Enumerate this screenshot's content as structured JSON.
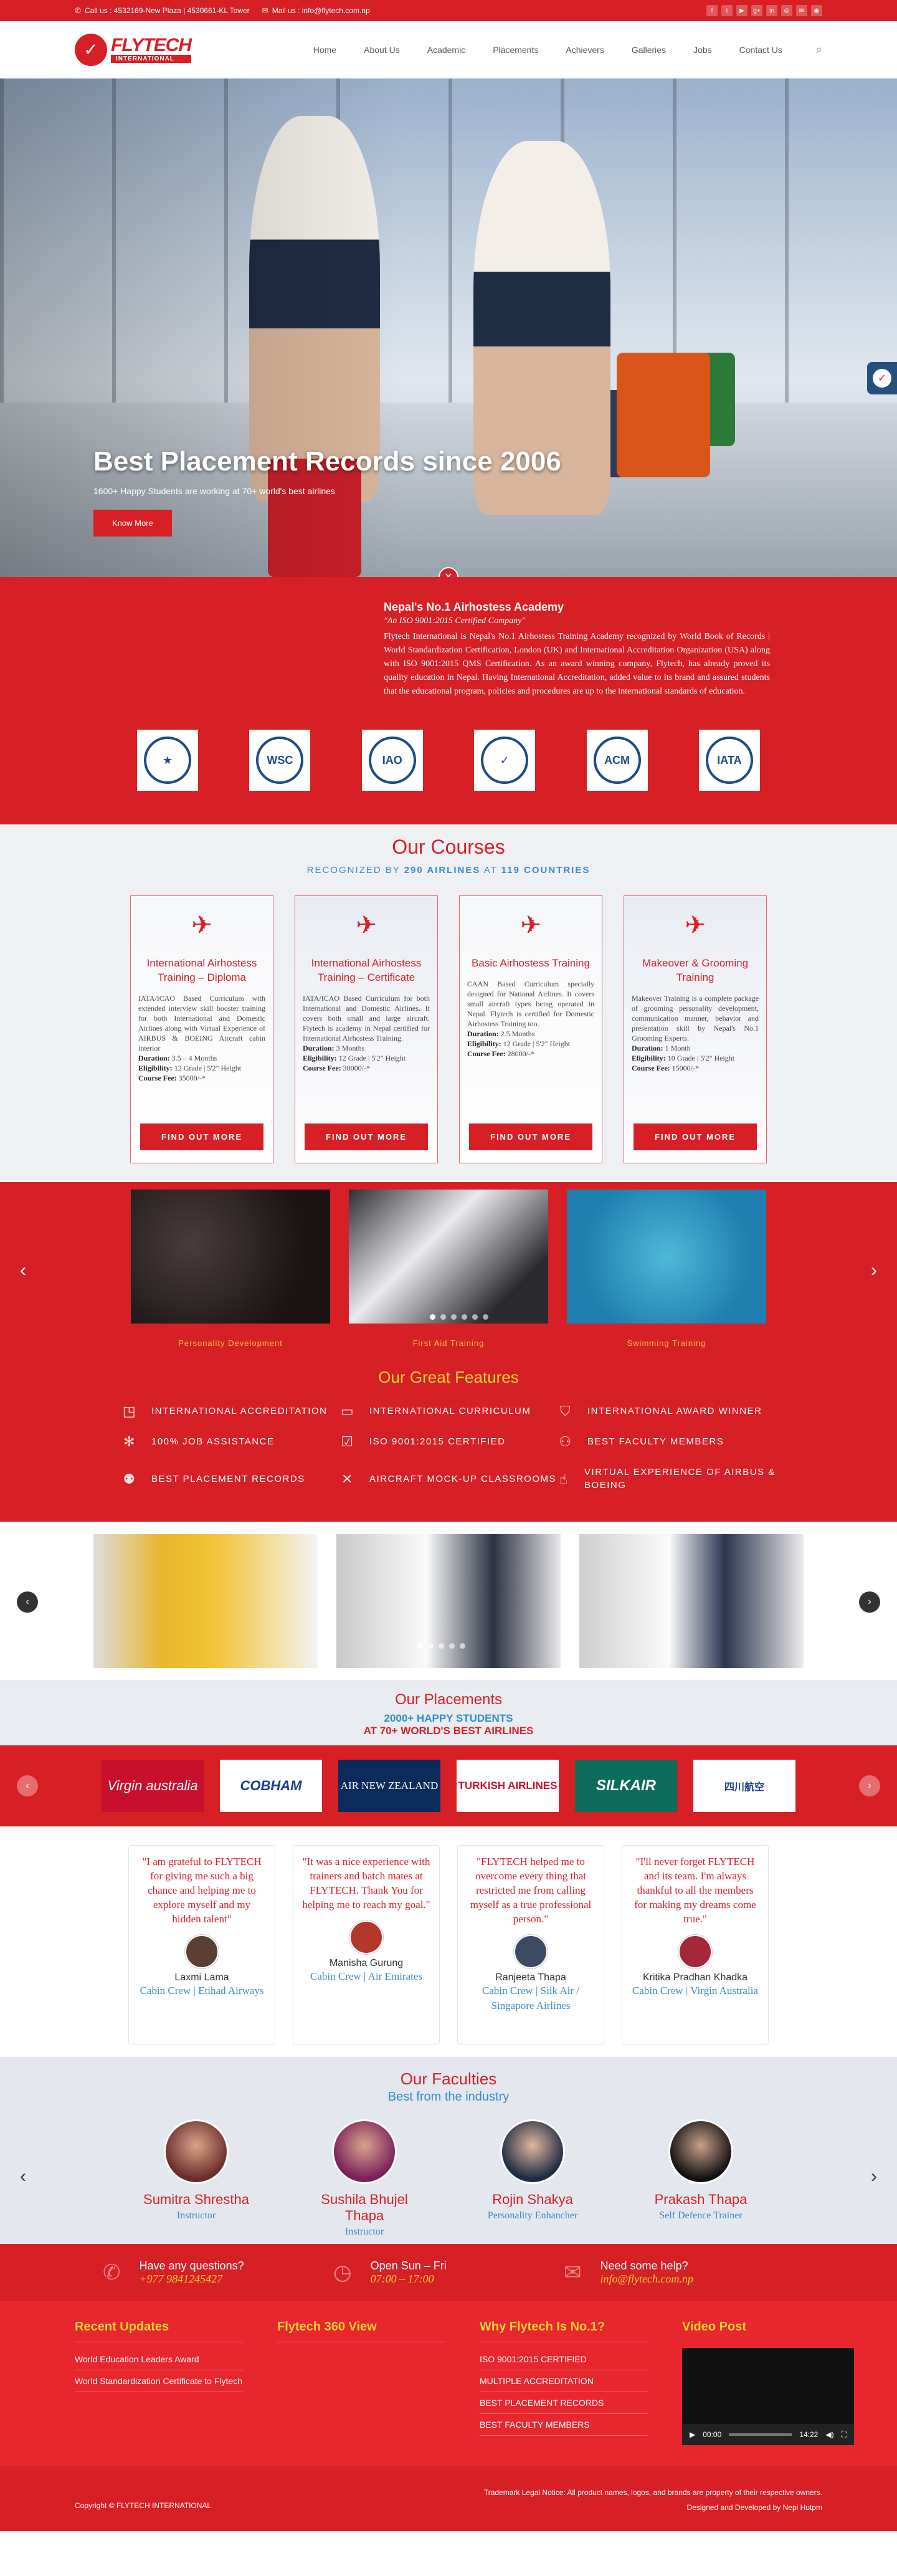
{
  "topbar": {
    "call": "Call us : 4532169-New Plaza | 4530661-KL Tower",
    "mail": "Mail us : info@flytech.com.np",
    "social": [
      "f",
      "t",
      "▶",
      "g+",
      "in",
      "◎",
      "✉",
      "◉"
    ]
  },
  "header": {
    "brand": "FLYTECH",
    "brand_sub": "INTERNATIONAL",
    "nav": [
      "Home",
      "About Us",
      "Academic",
      "Placements",
      "Achievers",
      "Galleries",
      "Jobs",
      "Contact Us"
    ]
  },
  "hero": {
    "title": "Best Placement Records since 2006",
    "subtitle": "1600+ Happy Students are working at 70+ world's best airlines",
    "button": "Know More",
    "close": "✕"
  },
  "about": {
    "heading": "Nepal's No.1 Airhostess Academy",
    "iso": "\"An ISO 9001:2015 Certified Company\"",
    "body": "Flytech International is Nepal's No.1 Airhostess Training Academy recognized by World Book of Records | World Standardization Certification, London (UK) and International Accreditation Organization (USA) along with ISO 9001:2015 QMS Certification. As an award winning company, Flytech, has already proved its quality education in Nepal. Having International Accreditation, added value to its brand and assured students that the educational program, policies and procedures are up to the international standards of education.",
    "certs": [
      "★",
      "WSC",
      "IAO",
      "✓",
      "ACM",
      "IATA"
    ]
  },
  "courses": {
    "title": "Our Courses",
    "tag_a": "RECOGNIZED BY ",
    "tag_b": "290 AIRLINES",
    "tag_c": " AT ",
    "tag_d": "119 COUNTRIES",
    "items": [
      {
        "title": "International Airhostess Training – Diploma",
        "desc": "IATA/ICAO Based Curriculum with extended interview skill booster training for both International and Domestic Airlines along with Virtual Experience of AIRBUS & BOEING Aircraft cabin interior",
        "duration_k": "Duration:",
        "duration_v": " 3.5 – 4 Months",
        "elig_k": "Eligibility:",
        "elig_v": " 12 Grade | 5'2\" Height",
        "fee_k": "Course Fee:",
        "fee_v": " 35000/-*",
        "button": "FIND OUT MORE"
      },
      {
        "title": "International Airhostess Training – Certificate",
        "desc": "IATA/ICAO Based Curriculum for both International and Domestic Airlines. It covers both small and large aircraft. Flytech is academy in Nepal certified for International Airhostess Training.",
        "duration_k": "Duration:",
        "duration_v": " 3 Months",
        "elig_k": "Eligibility:",
        "elig_v": " 12 Grade | 5'2\" Height",
        "fee_k": "Course Fee:",
        "fee_v": " 30000/-*",
        "button": "FIND OUT MORE"
      },
      {
        "title": "Basic Airhostess Training",
        "desc": "CAAN Based Curriculum specially designed for National Airlines. It covers small aircraft types being operated in Nepal. Flytech is certified for Domestic Airhostess Training too.",
        "duration_k": "Duration:",
        "duration_v": " 2.5 Months",
        "elig_k": "Eligibility:",
        "elig_v": " 12 Grade | 5'2\" Height",
        "fee_k": "Course Fee:",
        "fee_v": " 28000/-*",
        "button": "FIND OUT MORE"
      },
      {
        "title": "Makeover & Grooming Training",
        "desc": "Makeover Training is a complete package of grooming personality development, communication manner, behavior and presentation skill by Nepal's No.1 Grooming Experts.",
        "duration_k": "Duration:",
        "duration_v": " 1 Month",
        "elig_k": "Eligibility:",
        "elig_v": " 10 Grade | 5'2\" Height",
        "fee_k": "Course Fee:",
        "fee_v": " 15000/-*",
        "button": "FIND OUT MORE"
      }
    ]
  },
  "training": {
    "slides": [
      "Personality Development",
      "First Aid Training",
      "Swimming Training"
    ],
    "prev": "‹",
    "next": "›"
  },
  "features": {
    "title": "Our Great Features",
    "items": [
      {
        "icon": "◳",
        "label": "INTERNATIONAL ACCREDITATION"
      },
      {
        "icon": "▭",
        "label": "INTERNATIONAL CURRICULUM"
      },
      {
        "icon": "⛉",
        "label": "INTERNATIONAL AWARD WINNER"
      },
      {
        "icon": "✻",
        "label": "100% JOB ASSISTANCE"
      },
      {
        "icon": "☑",
        "label": "ISO 9001:2015 CERTIFIED"
      },
      {
        "icon": "⚇",
        "label": "BEST FACULTY MEMBERS"
      },
      {
        "icon": "⚉",
        "label": "BEST PLACEMENT RECORDS"
      },
      {
        "icon": "✕",
        "label": "AIRCRAFT MOCK-UP CLASSROOMS"
      },
      {
        "icon": "☝",
        "label": "VIRTUAL EXPERIENCE OF AIRBUS & BOEING"
      }
    ]
  },
  "gallery": {
    "prev": "‹",
    "next": "›"
  },
  "placements": {
    "title": "Our Placements",
    "line1": "2000+ HAPPY STUDENTS",
    "line2": "AT 70+ WORLD'S BEST AIRLINES",
    "airlines": [
      {
        "name": "Virgin australia",
        "bg": "#c8102e",
        "fg": "#ffffff"
      },
      {
        "name": "COBHAM",
        "bg": "#ffffff",
        "fg": "#1b3d8f"
      },
      {
        "name": "AIR NEW ZEALAND",
        "bg": "#0b2b5c",
        "fg": "#ffffff"
      },
      {
        "name": "TURKISH AIRLINES",
        "bg": "#ffffff",
        "fg": "#c8102e"
      },
      {
        "name": "SILKAIR",
        "bg": "#0c6b5a",
        "fg": "#ffffff"
      },
      {
        "name": "四川航空",
        "bg": "#ffffff",
        "fg": "#1b3d8f"
      }
    ],
    "prev": "‹",
    "next": "›"
  },
  "testimonials": [
    {
      "quote": "\"I am grateful to FLYTECH for giving me such a big chance and helping me to explore myself and my hidden talent\"",
      "name": "Laxmi Lama",
      "role": "Cabin Crew | Etihad Airways"
    },
    {
      "quote": "\"It was a nice experience with trainers and batch mates at FLYTECH. Thank You for helping me to reach my goal.\"",
      "name": "Manisha Gurung",
      "role": "Cabin Crew | Air Emirates"
    },
    {
      "quote": "\"FLYTECH helped me to overcome every thing that restricted me from calling myself as a true professional person.\"",
      "name": "Ranjeeta Thapa",
      "role": "Cabin Crew | Silk Air / Singapore Airlines"
    },
    {
      "quote": "\"I'll never forget FLYTECH and its team. I'm always thankful to all the members for making my dreams come true.\"",
      "name": "Kritika Pradhan Khadka",
      "role": "Cabin Crew | Virgin Australia"
    }
  ],
  "faculties": {
    "title": "Our Faculties",
    "subtitle": "Best from the industry",
    "items": [
      {
        "name": "Sumitra Shrestha",
        "role": "Instructor"
      },
      {
        "name": "Sushila Bhujel Thapa",
        "role": "Instructor"
      },
      {
        "name": "Rojin Shakya",
        "role": "Personality Enhancher"
      },
      {
        "name": "Prakash Thapa",
        "role": "Self Defence Trainer"
      }
    ],
    "prev": "‹",
    "next": "›"
  },
  "info": [
    {
      "icon": "✆",
      "t1": "Have any questions?",
      "t2": "+977 9841245427"
    },
    {
      "icon": "◷",
      "t1": "Open Sun – Fri",
      "t2": "07:00 – 17:00"
    },
    {
      "icon": "✉",
      "t1": "Need some help?",
      "t2": "info@flytech.com.np"
    }
  ],
  "footer": {
    "col1_title": "Recent Updates",
    "col1_items": [
      "World Education Leaders Award",
      "World Standardization Certificate to Flytech"
    ],
    "col2_title": "Flytech 360 View",
    "col3_title": "Why Flytech Is No.1?",
    "col3_items": [
      "ISO 9001:2015 CERTIFIED",
      "MULTIPLE ACCREDITATION",
      "BEST PLACEMENT RECORDS",
      "BEST FACULTY MEMBERS"
    ],
    "col4_title": "Video Post",
    "video_time_a": "00:00",
    "video_time_b": "14:22",
    "copyright": "Copyright © FLYTECH INTERNATIONAL",
    "trademark": "Trademark Legal Notice: All product names, logos, and brands are property of their respective owners.",
    "designed": "Designed and Developed by Nepi Hutpm"
  },
  "colors": {
    "accent": "#d71f26",
    "blue": "#3b8ac9",
    "yellow": "#f5d033"
  }
}
